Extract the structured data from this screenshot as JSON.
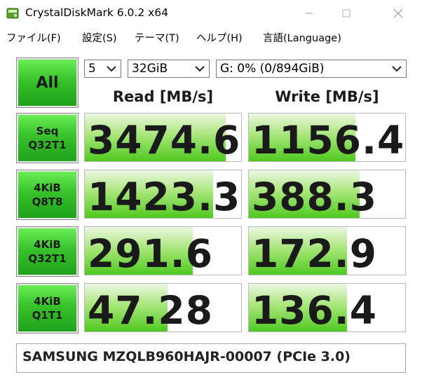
{
  "window": {
    "title": "CrystalDiskMark 6.0.2 x64",
    "minimize_icon": "minimize-icon",
    "maximize_icon": "maximize-icon",
    "close_icon": "close-icon"
  },
  "menu": [
    {
      "label": "ファイル(F)"
    },
    {
      "label": "設定(S)"
    },
    {
      "label": "テーマ(T)"
    },
    {
      "label": "ヘルプ(H)"
    },
    {
      "label": "言語(Language)"
    }
  ],
  "controls": {
    "all_label": "All",
    "count_value": "5",
    "size_value": "32GiB",
    "drive_value": "G: 0% (0/894GiB)"
  },
  "headers": {
    "read": "Read [MB/s]",
    "write": "Write [MB/s]"
  },
  "tests": [
    {
      "line1": "Seq",
      "line2": "Q32T1",
      "read": "3474.6",
      "read_level": 0.9,
      "write": "1156.4",
      "write_level": 0.68
    },
    {
      "line1": "4KiB",
      "line2": "Q8T8",
      "read": "1423.3",
      "read_level": 0.82,
      "write": "388.3",
      "write_level": 0.71
    },
    {
      "line1": "4KiB",
      "line2": "Q32T1",
      "read": "291.6",
      "read_level": 0.69,
      "write": "172.9",
      "write_level": 0.63
    },
    {
      "line1": "4KiB",
      "line2": "Q1T1",
      "read": "47.28",
      "read_level": 0.53,
      "write": "136.4",
      "write_level": 0.63
    }
  ],
  "comment": "SAMSUNG MZQLB960HAJR-00007 (PCIe 3.0)",
  "colors": {
    "button_green": "#38c22b",
    "bar_green": "#4fc91f"
  }
}
